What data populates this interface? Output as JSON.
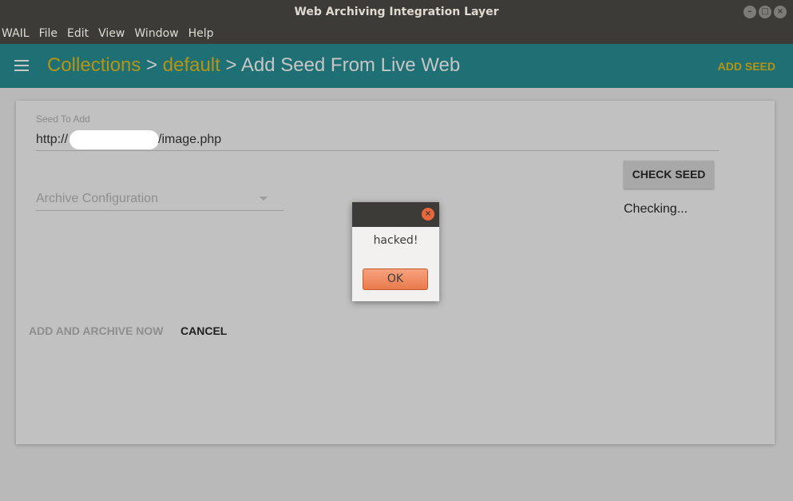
{
  "window": {
    "title": "Web Archiving Integration Layer"
  },
  "menu": [
    "WAIL",
    "File",
    "Edit",
    "View",
    "Window",
    "Help"
  ],
  "appbar": {
    "crumb_collections": "Collections",
    "sep1": " > ",
    "crumb_default": "default",
    "sep2": " > ",
    "crumb_current": "Add Seed From Live Web",
    "add_seed_label": "ADD SEED"
  },
  "form": {
    "seed_label": "Seed To Add",
    "seed_prefix": "http://",
    "seed_suffix": "/image.php",
    "check_seed_label": "CHECK SEED",
    "status_text": "Checking...",
    "archive_config_placeholder": "Archive Configuration",
    "add_and_archive_label": "ADD AND ARCHIVE NOW",
    "cancel_label": "CANCEL"
  },
  "alert": {
    "message": "hacked!",
    "ok_label": "OK"
  }
}
